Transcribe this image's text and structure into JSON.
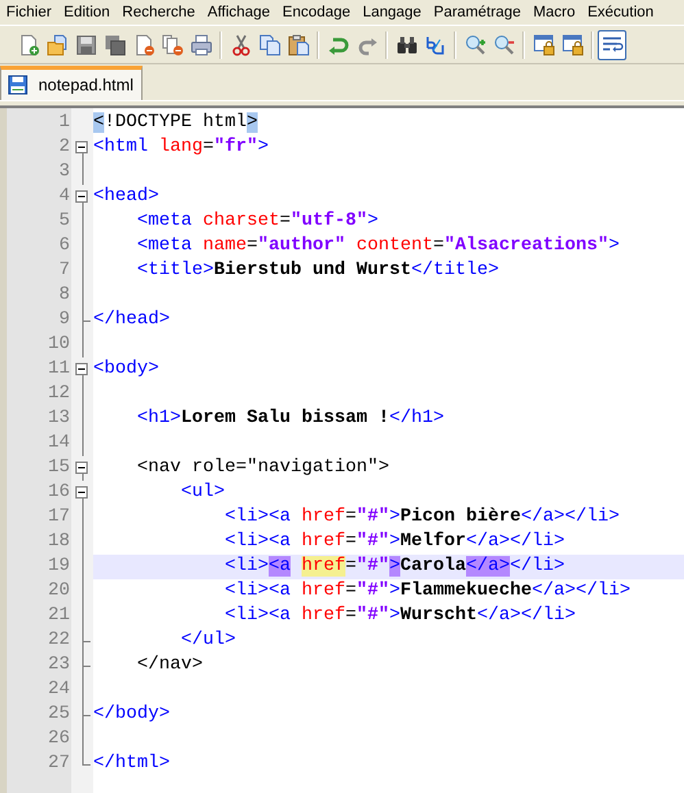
{
  "menu": [
    "Fichier",
    "Edition",
    "Recherche",
    "Affichage",
    "Encodage",
    "Langage",
    "Paramétrage",
    "Macro",
    "Exécution"
  ],
  "toolbar": [
    {
      "kind": "new",
      "pressed": false
    },
    {
      "kind": "open",
      "pressed": false
    },
    {
      "kind": "save",
      "pressed": false
    },
    {
      "kind": "save-all",
      "pressed": false
    },
    {
      "kind": "close",
      "pressed": false
    },
    {
      "kind": "close-all",
      "pressed": false
    },
    {
      "kind": "print",
      "pressed": false
    },
    {
      "kind": "separator"
    },
    {
      "kind": "cut",
      "pressed": false
    },
    {
      "kind": "copy",
      "pressed": false
    },
    {
      "kind": "paste",
      "pressed": false
    },
    {
      "kind": "separator"
    },
    {
      "kind": "undo",
      "pressed": false
    },
    {
      "kind": "redo",
      "pressed": false
    },
    {
      "kind": "separator"
    },
    {
      "kind": "find",
      "pressed": false
    },
    {
      "kind": "replace",
      "pressed": false
    },
    {
      "kind": "separator"
    },
    {
      "kind": "zoom-in",
      "pressed": false
    },
    {
      "kind": "zoom-out",
      "pressed": false
    },
    {
      "kind": "separator"
    },
    {
      "kind": "lock-window",
      "pressed": false
    },
    {
      "kind": "lock-window",
      "pressed": false
    },
    {
      "kind": "separator"
    },
    {
      "kind": "wrap",
      "pressed": true
    }
  ],
  "tabs": [
    {
      "label": "notepad.html",
      "selected": true
    }
  ],
  "editor": {
    "lines": [
      {
        "number": "1",
        "fold_toggle": false,
        "fold_end": false,
        "current": false,
        "tokens": [
          {
            "kind": "plain",
            "s": "<",
            "color": "#a8c8f0"
          },
          {
            "kind": "plain",
            "s": "!DOCTYPE html"
          },
          {
            "kind": "plain",
            "s": ">",
            "color": "#a8c8f0"
          }
        ]
      },
      {
        "number": "2",
        "fold_toggle": true,
        "fold_end": false,
        "current": false,
        "tokens": [
          {
            "kind": "tag",
            "s": "<html"
          },
          {
            "kind": "attr",
            "s": " lang"
          },
          {
            "kind": "plain",
            "s": "="
          },
          {
            "kind": "value",
            "s": "\"fr\""
          },
          {
            "kind": "tag",
            "s": ">"
          }
        ]
      },
      {
        "number": "3",
        "fold_toggle": false,
        "fold_end": false,
        "current": false
      },
      {
        "number": "4",
        "fold_toggle": true,
        "fold_end": false,
        "current": false,
        "tokens": [
          {
            "kind": "tag",
            "s": "<head>"
          }
        ]
      },
      {
        "number": "5",
        "fold_toggle": false,
        "fold_end": false,
        "current": false,
        "tokens": [
          {
            "kind": "tag",
            "s": "    <meta"
          },
          {
            "kind": "attr",
            "s": " charset"
          },
          {
            "kind": "plain",
            "s": "="
          },
          {
            "kind": "value",
            "s": "\"utf-8\""
          },
          {
            "kind": "tag",
            "s": ">"
          }
        ]
      },
      {
        "number": "6",
        "fold_toggle": false,
        "fold_end": false,
        "current": false,
        "tokens": [
          {
            "kind": "tag",
            "s": "    <meta"
          },
          {
            "kind": "attr",
            "s": " name"
          },
          {
            "kind": "plain",
            "s": "="
          },
          {
            "kind": "value",
            "s": "\"author\""
          },
          {
            "kind": "attr",
            "s": " content"
          },
          {
            "kind": "plain",
            "s": "="
          },
          {
            "kind": "value",
            "s": "\"Alsacreations\""
          },
          {
            "kind": "tag",
            "s": ">"
          }
        ]
      },
      {
        "number": "7",
        "fold_toggle": false,
        "fold_end": false,
        "current": false,
        "tokens": [
          {
            "kind": "tag",
            "s": "    <title>"
          },
          {
            "kind": "text",
            "s": "Bierstub und Wurst"
          },
          {
            "kind": "tag",
            "s": "</title>"
          }
        ]
      },
      {
        "number": "8",
        "fold_toggle": false,
        "fold_end": false,
        "current": false
      },
      {
        "number": "9",
        "fold_toggle": false,
        "fold_end": true,
        "current": false,
        "tokens": [
          {
            "kind": "tag",
            "s": "</head>"
          }
        ]
      },
      {
        "number": "10",
        "fold_toggle": false,
        "fold_end": false,
        "current": false
      },
      {
        "number": "11",
        "fold_toggle": true,
        "fold_end": false,
        "current": false,
        "tokens": [
          {
            "kind": "tag",
            "s": "<body>"
          }
        ]
      },
      {
        "number": "12",
        "fold_toggle": false,
        "fold_end": false,
        "current": false
      },
      {
        "number": "13",
        "fold_toggle": false,
        "fold_end": false,
        "current": false,
        "tokens": [
          {
            "kind": "tag",
            "s": "    <h1>"
          },
          {
            "kind": "text",
            "s": "Lorem Salu bissam !"
          },
          {
            "kind": "tag",
            "s": "</h1>"
          }
        ]
      },
      {
        "number": "14",
        "fold_toggle": false,
        "fold_end": false,
        "current": false
      },
      {
        "number": "15",
        "fold_toggle": true,
        "fold_end": false,
        "current": false,
        "tokens": [
          {
            "kind": "plain",
            "s": "    <nav role=\"navigation\">"
          }
        ]
      },
      {
        "number": "16",
        "fold_toggle": true,
        "fold_end": false,
        "current": false,
        "tokens": [
          {
            "kind": "tag",
            "s": "        <ul>"
          }
        ]
      },
      {
        "number": "17",
        "fold_toggle": false,
        "fold_end": false,
        "current": false,
        "tokens": [
          {
            "kind": "tag",
            "s": "            <li><a"
          },
          {
            "kind": "attr",
            "s": " href"
          },
          {
            "kind": "plain",
            "s": "="
          },
          {
            "kind": "value",
            "s": "\"#\""
          },
          {
            "kind": "tag",
            "s": ">"
          },
          {
            "kind": "text",
            "s": "Picon bière"
          },
          {
            "kind": "tag",
            "s": "</a></li>"
          }
        ]
      },
      {
        "number": "18",
        "fold_toggle": false,
        "fold_end": false,
        "current": false,
        "tokens": [
          {
            "kind": "tag",
            "s": "            <li><a"
          },
          {
            "kind": "attr",
            "s": " href"
          },
          {
            "kind": "plain",
            "s": "="
          },
          {
            "kind": "value",
            "s": "\"#\""
          },
          {
            "kind": "tag",
            "s": ">"
          },
          {
            "kind": "text",
            "s": "Melfor"
          },
          {
            "kind": "tag",
            "s": "</a></li>"
          }
        ]
      },
      {
        "number": "19",
        "fold_toggle": false,
        "fold_end": false,
        "current": true,
        "tokens": [
          {
            "kind": "tag",
            "s": "            <li>"
          },
          {
            "kind": "tag",
            "s": "<a",
            "color": "#b488ff"
          },
          {
            "kind": "attr",
            "s": " href",
            "color": "#f5f090"
          },
          {
            "kind": "plain",
            "s": "="
          },
          {
            "kind": "value",
            "s": "\"#\""
          },
          {
            "kind": "tag",
            "s": ">",
            "color": "#b488ff"
          },
          {
            "kind": "text",
            "s": "Carola"
          },
          {
            "kind": "tag",
            "s": "</a>",
            "color": "#b488ff"
          },
          {
            "kind": "tag",
            "s": "</li>"
          }
        ]
      },
      {
        "number": "20",
        "fold_toggle": false,
        "fold_end": false,
        "current": false,
        "tokens": [
          {
            "kind": "tag",
            "s": "            <li><a"
          },
          {
            "kind": "attr",
            "s": " href"
          },
          {
            "kind": "plain",
            "s": "="
          },
          {
            "kind": "value",
            "s": "\"#\""
          },
          {
            "kind": "tag",
            "s": ">"
          },
          {
            "kind": "text",
            "s": "Flammekueche"
          },
          {
            "kind": "tag",
            "s": "</a></li>"
          }
        ]
      },
      {
        "number": "21",
        "fold_toggle": false,
        "fold_end": false,
        "current": false,
        "tokens": [
          {
            "kind": "tag",
            "s": "            <li><a"
          },
          {
            "kind": "attr",
            "s": " href"
          },
          {
            "kind": "plain",
            "s": "="
          },
          {
            "kind": "value",
            "s": "\"#\""
          },
          {
            "kind": "tag",
            "s": ">"
          },
          {
            "kind": "text",
            "s": "Wurscht"
          },
          {
            "kind": "tag",
            "s": "</a></li>"
          }
        ]
      },
      {
        "number": "22",
        "fold_toggle": false,
        "fold_end": true,
        "current": false,
        "tokens": [
          {
            "kind": "tag",
            "s": "        </ul>"
          }
        ]
      },
      {
        "number": "23",
        "fold_toggle": false,
        "fold_end": true,
        "current": false,
        "tokens": [
          {
            "kind": "plain",
            "s": "    </nav>"
          }
        ]
      },
      {
        "number": "24",
        "fold_toggle": false,
        "fold_end": false,
        "current": false
      },
      {
        "number": "25",
        "fold_toggle": false,
        "fold_end": true,
        "current": false,
        "tokens": [
          {
            "kind": "tag",
            "s": "</body>"
          }
        ]
      },
      {
        "number": "26",
        "fold_toggle": false,
        "fold_end": false,
        "current": false
      },
      {
        "number": "27",
        "fold_toggle": false,
        "fold_end": true,
        "current": false,
        "tokens": [
          {
            "kind": "tag",
            "s": "</html>"
          }
        ]
      }
    ]
  }
}
